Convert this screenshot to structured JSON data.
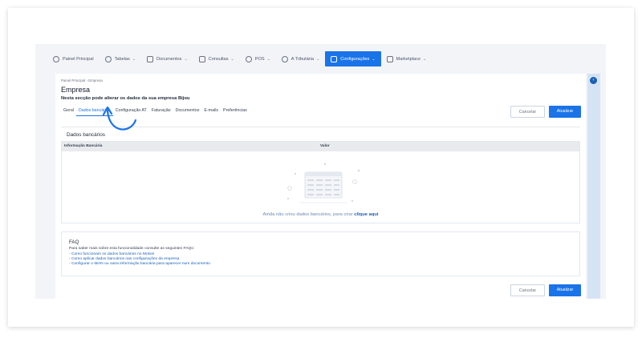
{
  "nav": {
    "items": [
      {
        "label": "Painel Principal",
        "chev": ""
      },
      {
        "label": "Tabelas",
        "chev": "⌄"
      },
      {
        "label": "Documentos",
        "chev": "⌄"
      },
      {
        "label": "Consultas",
        "chev": "⌄"
      },
      {
        "label": "POS",
        "chev": "⌄"
      },
      {
        "label": "A Tributária",
        "chev": "⌄"
      },
      {
        "label": "Configurações",
        "chev": "⌄"
      },
      {
        "label": "Marketplace",
        "chev": "⌄"
      }
    ]
  },
  "breadcrumb": {
    "home": "Painel Principal",
    "sep": "›",
    "current": "Empresa"
  },
  "page": {
    "title": "Empresa",
    "subtitle_prefix": "Nesta secção pode alterar os dados da sua empresa ",
    "company": "Bijou"
  },
  "tabs": [
    "Geral",
    "Dados bancários",
    "Configuração AT",
    "Faturação",
    "Documentos",
    "E-mails",
    "Preferências"
  ],
  "actions": {
    "cancel": "Cancelar",
    "update": "Atualizar"
  },
  "bank": {
    "title": "Dados bancários",
    "col_info": "Informação Bancária",
    "col_value": "Valor",
    "empty_prefix": "Ainda não criou dados bancários, para criar ",
    "empty_link": "clique aqui"
  },
  "faq": {
    "title": "FAQ",
    "intro": "Para saber mais sobre esta funcionalidade consulte as seguintes FAQs:",
    "links": [
      "- Como funcionam os dados bancários no Moloni",
      "- Como aplicar dados bancários nas configurações da empresa",
      "- Configurar o IBAN ou outra informação bancária para aparecer num documento"
    ]
  },
  "colors": {
    "accent": "#1a73e8",
    "link": "#1a5fb4"
  }
}
